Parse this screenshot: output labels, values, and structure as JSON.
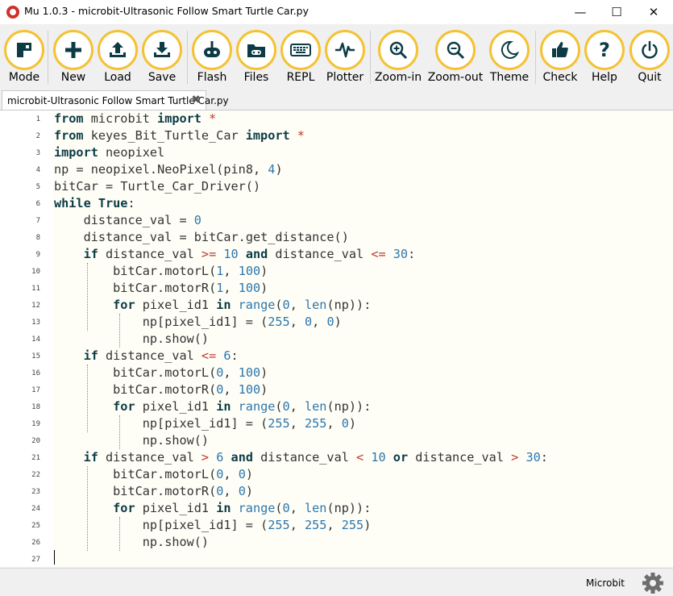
{
  "window": {
    "title": "Mu 1.0.3 - microbit-Ultrasonic Follow Smart Turtle Car.py",
    "controls": {
      "minimize": "—",
      "maximize": "☐",
      "close": "✕"
    }
  },
  "toolbar": {
    "accent_color": "#f4c233",
    "buttons": [
      {
        "label": "Mode",
        "icon": "mode-icon"
      },
      {
        "label": "New",
        "icon": "plus-icon"
      },
      {
        "label": "Load",
        "icon": "upload-icon"
      },
      {
        "label": "Save",
        "icon": "download-icon"
      },
      {
        "label": "Flash",
        "icon": "flash-icon"
      },
      {
        "label": "Files",
        "icon": "files-icon"
      },
      {
        "label": "REPL",
        "icon": "keyboard-icon"
      },
      {
        "label": "Plotter",
        "icon": "pulse-icon"
      },
      {
        "label": "Zoom-in",
        "icon": "zoom-in-icon"
      },
      {
        "label": "Zoom-out",
        "icon": "zoom-out-icon"
      },
      {
        "label": "Theme",
        "icon": "moon-icon"
      },
      {
        "label": "Check",
        "icon": "thumbs-up-icon"
      },
      {
        "label": "Help",
        "icon": "question-icon"
      },
      {
        "label": "Quit",
        "icon": "power-icon"
      }
    ]
  },
  "tabs": [
    {
      "label": "microbit-Ultrasonic Follow Smart Turtle Car.py",
      "close": "✖"
    }
  ],
  "editor": {
    "line_numbers": [
      "1",
      "2",
      "3",
      "4",
      "5",
      "6",
      "7",
      "8",
      "9",
      "10",
      "11",
      "12",
      "13",
      "14",
      "15",
      "16",
      "17",
      "18",
      "19",
      "20",
      "21",
      "22",
      "23",
      "24",
      "25",
      "26",
      "27"
    ],
    "lines": [
      "from microbit import *",
      "from keyes_Bit_Turtle_Car import *",
      "import neopixel",
      "np = neopixel.NeoPixel(pin8, 4)",
      "bitCar = Turtle_Car_Driver()",
      "while True:",
      "    distance_val = 0",
      "    distance_val = bitCar.get_distance()",
      "    if distance_val >= 10 and distance_val <= 30:",
      "        bitCar.motorL(1, 100)",
      "        bitCar.motorR(1, 100)",
      "        for pixel_id1 in range(0, len(np)):",
      "            np[pixel_id1] = (255, 0, 0)",
      "            np.show()",
      "    if distance_val <= 6:",
      "        bitCar.motorL(0, 100)",
      "        bitCar.motorR(0, 100)",
      "        for pixel_id1 in range(0, len(np)):",
      "            np[pixel_id1] = (255, 255, 0)",
      "            np.show()",
      "    if distance_val > 6 and distance_val < 10 or distance_val > 30:",
      "        bitCar.motorL(0, 0)",
      "        bitCar.motorR(0, 0)",
      "        for pixel_id1 in range(0, len(np)):",
      "            np[pixel_id1] = (255, 255, 255)",
      "            np.show()",
      ""
    ]
  },
  "status": {
    "mode": "Microbit",
    "settings_icon": "gear-icon"
  }
}
